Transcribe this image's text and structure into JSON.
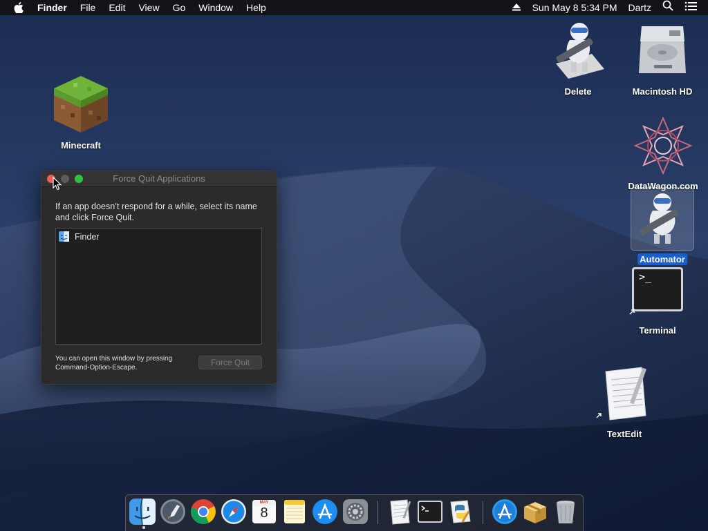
{
  "menubar": {
    "app_name": "Finder",
    "menus": [
      "File",
      "Edit",
      "View",
      "Go",
      "Window",
      "Help"
    ],
    "clock": "Sun May 8  5:34 PM",
    "user": "Dartz"
  },
  "desktop_icons": {
    "minecraft": "Minecraft",
    "delete": "Delete",
    "macintosh_hd": "Macintosh HD",
    "datawagon": "DataWagon.com",
    "automator": "Automator",
    "terminal": "Terminal",
    "textedit": "TextEdit"
  },
  "force_quit": {
    "title": "Force Quit Applications",
    "description": "If an app doesn’t respond for a while, select its name and click Force Quit.",
    "apps": [
      "Finder"
    ],
    "hint": "You can open this window by pressing Command-Option-Escape.",
    "button_label": "Force Quit"
  },
  "terminal_prompt": ">_",
  "calendar": {
    "month": "MAY",
    "day": "8"
  },
  "dock_items": [
    "finder-icon",
    "launchpad-icon",
    "chrome-icon",
    "safari-icon",
    "calendar-icon",
    "notes-icon",
    "app-store-icon",
    "system-preferences-icon",
    "textedit-icon",
    "terminal-icon",
    "python-launcher-icon",
    "downloads-app-store-icon",
    "installer-icon",
    "trash-icon"
  ],
  "colors": {
    "selection": "#1a5fd0",
    "close_button": "#ee5f58",
    "zoom_button": "#2dc240"
  }
}
